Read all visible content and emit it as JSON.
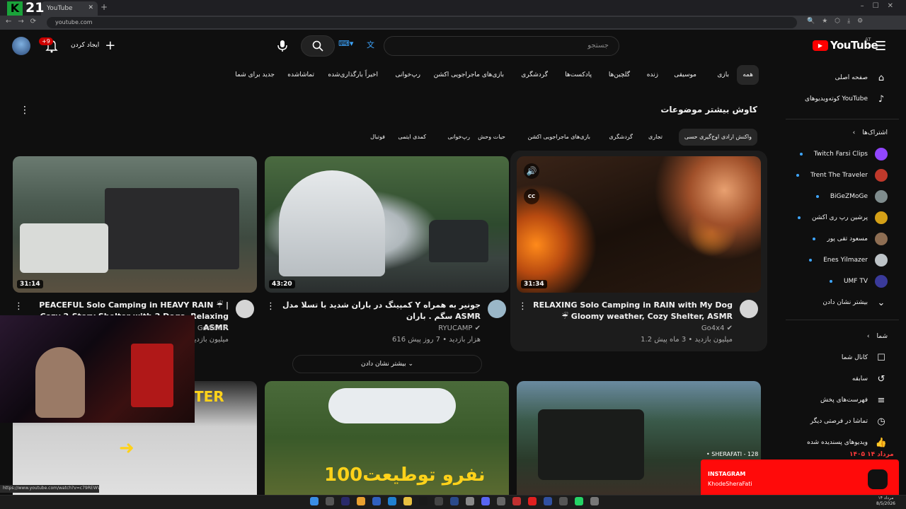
{
  "browser": {
    "tab_title": "YouTube",
    "url": "youtube.com",
    "status_url": "https://www.youtube.com/watch?v=c79REWVZDbI"
  },
  "stream_overlay": {
    "logo_letter": "K",
    "logo_number": "21",
    "channel_line": "• SHERAFATI - 128",
    "date": "۱۴۰۵ مرداد ۱۴",
    "label": "INSTAGRAM",
    "handle": "KhodeSheraFati"
  },
  "header": {
    "logo_text": "YouTube",
    "region": "AT",
    "search_placeholder": "جستجو",
    "create_label": "ایجاد کردن",
    "notification_count": "+9"
  },
  "chips": [
    "همه",
    "بازی",
    "موسیقی",
    "زنده",
    "گلچین‌ها",
    "پادکست‌ها",
    "گردشگری",
    "بازی‌های ماجراجویی اکشن",
    "رپ‌خوانی",
    "اخیراً بارگذاری‌شده",
    "تماشاشده",
    "جدید برای شما"
  ],
  "sidebar": {
    "home": "صفحه اصلی",
    "shorts": "کوته‌ویدیوهای YouTube",
    "subs_header": "اشتراک‌ها",
    "subscriptions": [
      {
        "name": "Twitch Farsi Clips",
        "color": "#9146ff"
      },
      {
        "name": "Trent The Traveler",
        "color": "#c0392b"
      },
      {
        "name": "BiGeZMoGe",
        "color": "#7f8c8d"
      },
      {
        "name": "پرشین رپ ری اکشن",
        "color": "#d4a017"
      },
      {
        "name": "مسعود تقی پور",
        "color": "#8e6e53"
      },
      {
        "name": "Enes Yilmazer",
        "color": "#bdc3c7"
      },
      {
        "name": "UMF TV",
        "color": "#3a3a9a"
      }
    ],
    "show_more": "بیشتر نشان دادن",
    "you_header": "شما",
    "you_items": [
      "کانال شما",
      "سابقه",
      "فهرست‌های پخش",
      "تماشا در فرصتی دیگر",
      "ویدیوهای پسندیده شده"
    ]
  },
  "section": {
    "title": "کاوش بیشتر موضوعات",
    "topics": [
      "واکنش ارادی اوج‌گیری حسی",
      "تجاری",
      "گردشگری",
      "بازی‌های ماجراجویی اکشن",
      "حیات وحش",
      "رپ‌خوانی",
      "کمدی ایتمی",
      "فوتبال"
    ],
    "show_more": "بیشتر نشان دادن"
  },
  "videos": [
    {
      "title": "RELAXING Solo Camping in RAIN with My Dog ☔ Gloomy weather, Cozy Shelter, ASMR",
      "channel": "Go4x4",
      "meta": "1.2 میلیون بازدید • 3 ماه پیش",
      "duration": "31:34"
    },
    {
      "title": "کمپینگ در باران شدید با تسلا مدل Y جونیر به همراه سگم . باران ASMR",
      "channel": "RYUCAMP",
      "meta": "616 هزار بازدید • 7 روز پیش",
      "duration": "43:20"
    },
    {
      "title": "PEACEFUL Solo Camping in HEAVY RAIN ☔ | Cozy 2-Story Shelter with 2 Dogs, Relaxing ASMR",
      "channel": "Go4x4",
      "meta": "12 میلیون بازدید",
      "duration": "31:14"
    }
  ],
  "row2": {
    "thumb_text_mid": "100نفرو توطیعت",
    "thumb_text_left": "TER"
  },
  "taskbar": {
    "time_line1": "۱۴ مرداد",
    "time_line2": "8/5/2026"
  }
}
